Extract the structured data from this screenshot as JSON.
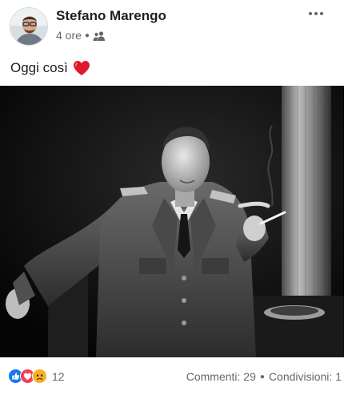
{
  "post": {
    "author": "Stefano Marengo",
    "time": "4 ore",
    "audience_icon": "friends-icon",
    "text": "Oggi così",
    "emoji_icon": "red-heart-icon",
    "photo_icon": "portrait-photo"
  },
  "footer": {
    "reaction_icons": [
      "like-icon",
      "love-icon",
      "sad-icon"
    ],
    "reaction_count": "12",
    "comments": "Commenti: 29",
    "shares": "Condivisioni: 1"
  },
  "colors": {
    "like": "#1877f2",
    "love": "#f33e58",
    "sad": "#f7b125",
    "muted_text": "#65676b"
  }
}
